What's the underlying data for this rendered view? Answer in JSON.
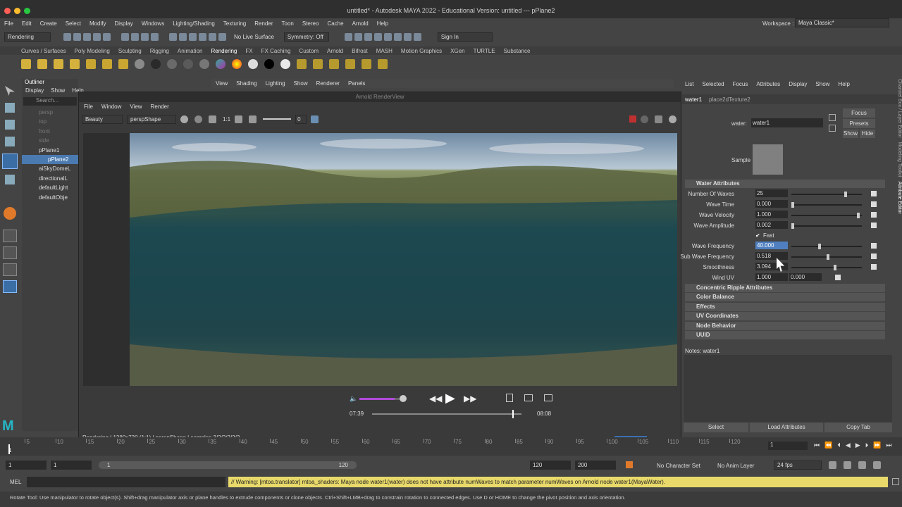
{
  "window": {
    "title": "untitled* - Autodesk MAYA 2022 - Educational Version: untitled  ---  pPlane2"
  },
  "menu": [
    "File",
    "Edit",
    "Create",
    "Select",
    "Modify",
    "Display",
    "Windows",
    "Lighting/Shading",
    "Texturing",
    "Render",
    "Toon",
    "Stereo",
    "Cache",
    "Arnold",
    "Help"
  ],
  "workspace": {
    "label": "Workspace :",
    "value": "Maya Classic*"
  },
  "toolbar": {
    "mode": "Rendering",
    "live": "No Live Surface",
    "symmetry": "Symmetry: Off",
    "signin": "Sign In"
  },
  "shelf_tabs": [
    "Curves / Surfaces",
    "Poly Modeling",
    "Sculpting",
    "Rigging",
    "Animation",
    "Rendering",
    "FX",
    "FX Caching",
    "Custom",
    "Arnold",
    "Bifrost",
    "MASH",
    "Motion Graphics",
    "XGen",
    "TURTLE",
    "Substance"
  ],
  "outliner": {
    "title": "Outliner",
    "menu": [
      "Display",
      "Show",
      "Help"
    ],
    "search": "Search...",
    "items": [
      "persp",
      "top",
      "front",
      "side",
      "pPlane1",
      "pPlane2",
      "aiSkyDomeL",
      "directionalL",
      "defaultLight",
      "defaultObje"
    ]
  },
  "viewport_menu": [
    "View",
    "Shading",
    "Lighting",
    "Show",
    "Renderer",
    "Panels"
  ],
  "renderview": {
    "title": "Arnold RenderView",
    "menu": [
      "File",
      "Window",
      "View",
      "Render"
    ],
    "aov": "Beauty",
    "camera": "perspShape",
    "ratio": "1:1",
    "exposure": "0",
    "status": "Rendering | 1280x720 (1:1) | perspShape | samples 3/2/2/2/2/2"
  },
  "video": {
    "time": "07:39",
    "duration": "08:08",
    "progress": 0.94,
    "volume": 0.8
  },
  "attr_menu": [
    "List",
    "Selected",
    "Focus",
    "Attributes",
    "Display",
    "Show",
    "Help"
  ],
  "attr_tabs": [
    "water1",
    "place2dTexture2"
  ],
  "attr": {
    "node_label": "water:",
    "node": "water1",
    "focus": "Focus",
    "presets": "Presets",
    "show": "Show",
    "hide": "Hide",
    "sample": "Sample",
    "section": "Water Attributes",
    "rows": [
      {
        "label": "Number Of Waves",
        "value": "25",
        "knob": 0.78
      },
      {
        "label": "Wave Time",
        "value": "0.000",
        "knob": 0.0
      },
      {
        "label": "Wave Velocity",
        "value": "1.000",
        "knob": 0.97
      },
      {
        "label": "Wave Amplitude",
        "value": "0.002",
        "knob": 0.0
      },
      {
        "label": "Wave Frequency",
        "value": "40.000",
        "knob": 0.4
      },
      {
        "label": "Sub Wave Frequency",
        "value": "0.518",
        "knob": 0.52
      },
      {
        "label": "Smoothness",
        "value": "3.094",
        "knob": 0.62
      }
    ],
    "fast": "Fast",
    "wind_label": "Wind UV",
    "wind_u": "1.000",
    "wind_v": "0.000",
    "sections": [
      "Concentric Ripple Attributes",
      "Color Balance",
      "Effects",
      "UV Coordinates",
      "Node Behavior",
      "UUID"
    ],
    "notes": "Notes:  water1",
    "buttons": [
      "Select",
      "Load Attributes",
      "Copy Tab"
    ]
  },
  "side_tabs": [
    "Channel Box / Layer Editor",
    "Modeling Toolkit",
    "Attribute Editor"
  ],
  "timeline": {
    "ticks": [
      "5",
      "10",
      "15",
      "20",
      "25",
      "30",
      "35",
      "40",
      "45",
      "50",
      "55",
      "60",
      "65",
      "70",
      "75",
      "80",
      "85",
      "90",
      "95",
      "100",
      "105",
      "110",
      "115",
      "120"
    ],
    "current": "1",
    "frame": "1"
  },
  "range": {
    "start": "1",
    "start2": "1",
    "slider_start": "1",
    "slider_end": "120",
    "end": "120",
    "end2": "200",
    "char": "No Character Set",
    "anim": "No Anim Layer",
    "fps": "24 fps"
  },
  "cmd": {
    "label": "MEL",
    "warning": "// Warning: [mtoa.translator]  mtoa_shaders: Maya node water1(water) does not have attribute numWaves to match parameter numWaves on Arnold node water1(MayaWater)."
  },
  "help": "Rotate Tool: Use manipulator to rotate object(s). Shift+drag manipulator axis or plane handles to extrude components or clone objects. Ctrl+Shift+LMB+drag to constrain rotation to connected edges. Use D or HOME to change the pivot position and axis orientation."
}
